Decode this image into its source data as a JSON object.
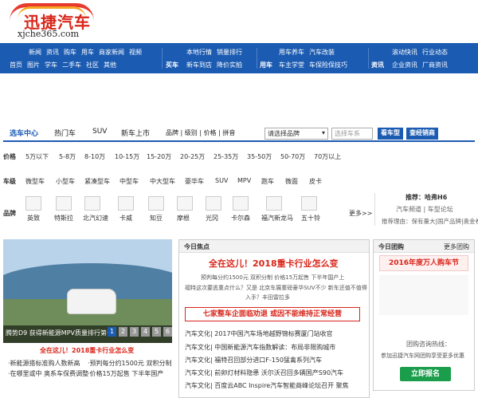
{
  "logo": {
    "cn": "迅捷汽车",
    "en": "xjche365.com"
  },
  "nav": {
    "g1": {
      "r1": [
        "新闻",
        "资讯",
        "购车",
        "用车",
        "商家新闻",
        "视频"
      ],
      "r2": [
        "首页",
        "图片",
        "学车",
        "二手车",
        "社区",
        "其他"
      ]
    },
    "g2": {
      "lab": "买车",
      "r1": [
        "本地行情",
        "销量排行"
      ],
      "r2": [
        "新车到店",
        "降价实拍"
      ]
    },
    "g3": {
      "lab": "用车",
      "r1": [
        "用车养车",
        "汽车改装"
      ],
      "r2": [
        "车主学堂",
        "车保险保技巧"
      ]
    },
    "g4": {
      "lab": "资讯",
      "r1": [
        "滚动快讯",
        "行业动态"
      ],
      "r2": [
        "企业资讯",
        "厂商资讯"
      ]
    }
  },
  "tabs": [
    "选车中心",
    "热门车",
    "SUV",
    "新车上市"
  ],
  "filter_links": [
    "品牌",
    "级别",
    "价格",
    "拼音"
  ],
  "select_brand": "请选择品牌",
  "select_series": "选择车系",
  "btn_view": "看车型",
  "btn_dealer": "查经销商",
  "price": {
    "label": "价格",
    "items": [
      "5万以下",
      "5-8万",
      "8-10万",
      "10-15万",
      "15-20万",
      "20-25万",
      "25-35万",
      "35-50万",
      "50-70万",
      "70万以上"
    ],
    "active": "8-10万"
  },
  "level": {
    "label": "车级",
    "items": [
      "微型车",
      "小型车",
      "紧凑型车",
      "中型车",
      "中大型车",
      "豪华车",
      "SUV",
      "MPV",
      "跑车",
      "微面",
      "皮卡"
    ],
    "active": "SUV"
  },
  "brand": {
    "label": "品牌",
    "items": [
      "英致",
      "特斯拉",
      "北汽幻速",
      "卡威",
      "知豆",
      "摩根",
      "光冈",
      "卡尔森",
      "福汽新龙马",
      "五十铃"
    ],
    "more": "更多>>"
  },
  "recommend": {
    "title": "推荐：哈弗H6",
    "links": "汽车频道 | 车型论坛",
    "reason": "推荐理由：保有量大|国产品牌|奥金卷"
  },
  "slide": {
    "caption": "腾势D9 获得新能源MPV质量排行第一",
    "pages": [
      "1",
      "2",
      "3",
      "4",
      "5",
      "6"
    ]
  },
  "left_news": {
    "title": "全在这儿！2018重卡行业怎么变",
    "items": [
      "·新能源搭标准购人数新高",
      "·预判每分约1500元 双积分制",
      "·在哪里或中 奥系车保费调整",
      "·价格15万起售 下半年国产"
    ]
  },
  "focus": {
    "tab": "今日焦点",
    "headline": "全在这儿！2018重卡行业怎么变",
    "desc1": "预判每分约1500元 双积分制 价格15万起售 下半年国产上",
    "desc2": "福特这次要逃重点什么？又是 北京车展重磅豪华SUV不少 新车还值不值得",
    "desc3": "入手？丰田雷拉多",
    "headline2": "七家整车企面临劝退 或因不能维持正常经营",
    "items": [
      "汽车文化| 2017中国汽车场地越野锦标赛厦门站收官",
      "汽车文化| 中国新能源汽车指数解读：布局非限购城市",
      "汽车文化| 福特召回部分进口F-150猛禽系列汽车",
      "汽车文化| 前卵灯材料隐患 沃尔沃召回多辆国产S90汽车",
      "汽车文化| 百度云ABC Inspire汽车智能商峰论坛召开 聚焦"
    ]
  },
  "group": {
    "tab": "今日团购",
    "more": "更多团购",
    "title": "2016年度万人购车节",
    "hotline": "团购咨询热线：",
    "desc": "参加迅捷汽车网团购享受更多优惠",
    "btn": "立即报名"
  },
  "colors": {
    "nav": "#1b5bb2",
    "accent": "#d8261a"
  }
}
